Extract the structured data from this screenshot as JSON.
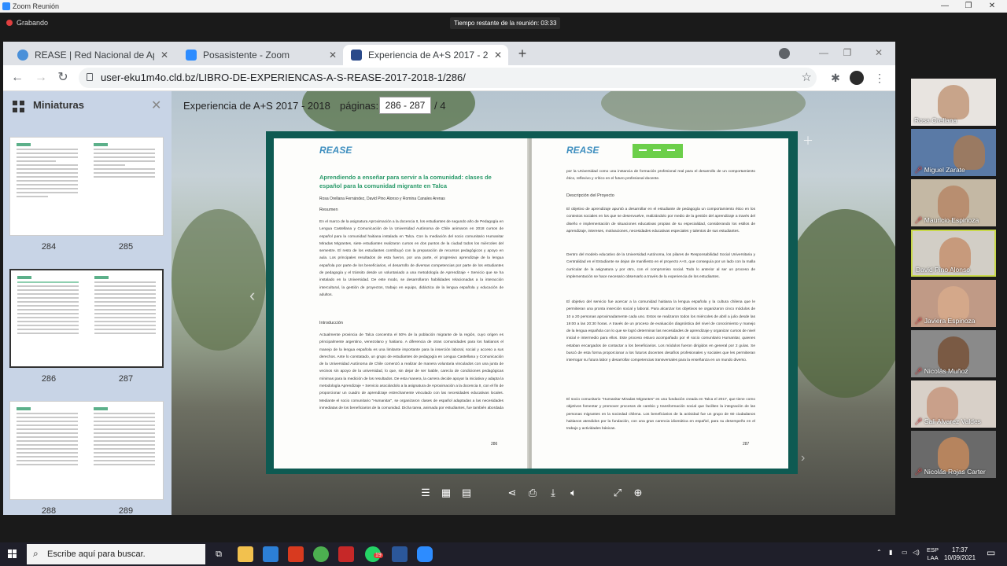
{
  "zoom": {
    "window_title": "Zoom Reunión",
    "recording_label": "Grabando",
    "timer_text": "Tiempo restante de la reunión: 03:33"
  },
  "browser": {
    "tabs": [
      {
        "label": "REASE | Red Nacional de Aprendiz",
        "icon": "globe-icon",
        "active": false
      },
      {
        "label": "Posasistente - Zoom",
        "icon": "zoom-icon",
        "active": false
      },
      {
        "label": "Experiencia de A+S 2017 - 2018",
        "icon": "book-icon",
        "active": true
      }
    ],
    "url": "user-eku1m4o.cld.bz/LIBRO-DE-EXPERIENCAS-A-S-REASE-2017-2018-1/286/"
  },
  "viewer": {
    "thumbs_title": "Miniaturas",
    "title": "Experiencia de A+S 2017 - 2018",
    "pages_label": "páginas:",
    "pages_value": "286 - 287",
    "pages_total": "/ 4",
    "thumb_pages": [
      {
        "left": "284",
        "right": "285"
      },
      {
        "left": "286",
        "right": "287"
      },
      {
        "left": "288",
        "right": "289"
      }
    ]
  },
  "page_left": {
    "logo": "REASE",
    "heading": "Aprendiendo a enseñar para servir a la comunidad: clases de español para la comunidad migrante en Talca",
    "authors": "Rosa Orellana Fernández, David Pino Alonso y Romina Canales Arenas",
    "resumen_title": "Resumen",
    "resumen": "En el marco de la asignatura Aproximación a la docencia II, los estudiantes de segundo año de Pedagogía en Lengua Castellana y Comunicación de la Universidad Autónoma de Chile animaron en 2018 cursos de español para la comunidad haitiana instalada en Talca. Con la mediación del socio comunitario Humanitar Miradas Migrantes, siete estudiantes realizaron cursos en dos puntos de la ciudad todos los miércoles del semestre. El resto de los estudiantes contribuyó con la preparación de recursos pedagógicos y apoyo en aula. Los principales resultados de esta fueron, por una parte, el progresivo aprendizaje de la lengua española por parte de los beneficiarios, el desarrollo de diversas competencias por parte de los estudiantes de pedagogía y el tránsito desde un voluntariado a una metodología de Aprendizaje + Servicio que se ha instalado en la Universidad. De este modo, se desarrollaron habilidades relacionadas a la interacción intercultural, la gestión de proyectos, trabajo en equipo, didáctica de la lengua española y educación de adultos.",
    "intro_title": "Introducción",
    "intro": "Actualmente provincia de Talca concentra el 50% de la población migrante de la región, cuyo origen es principalmente argentino, venezolano y haitiano. A diferencia de otras comunidades para los haitianos el manejo de la lengua española es una limitante importante para la inserción laboral, social y acceso a sus derechos. Ante lo constatado, un grupo de estudiantes de pedagogía en Lengua Castellana y Comunicación de la Universidad Autónoma de Chile comenzó a realizar de manera voluntaria vinculados con una junta de vecinos sin apoyo de la universidad, lo que, sin dejar de ser loable, carecía de condiciones pedagógicas mínimas para la medición de los resultados. De esta manera, la carrera decide apoyar la iniciativa y adapta la metodología Aprendizaje + Servicio asociándolo a la asignatura de Aproximación a la docencia II, con el fin de proporcionar un cuadro de aprendizaje estrechamente vinculado con las necesidades educativas locales. Mediante el socio comunitario \"Humanitar\", se organizaron clases de español adaptadas a las necesidades inmediatas de los beneficiarios de la comunidad. Dicha tarea, animada por estudiantes, fue también abordada",
    "page_number": "286"
  },
  "page_right": {
    "logo": "REASE",
    "p1": "por la Universidad como una instancia de formación profesional real para el desarrollo de un comportamiento ético, reflexivo y crítico en el futuro profesional docente.",
    "desc_title": "Descripción del Proyecto",
    "p2": "El objetivo de aprendizaje apuntó a desarrollar en el estudiante de pedagogía un comportamiento ético en los contextos sociales en los que se desenvuelve, realizándolo por medio de la gestión del aprendizaje a través del diseño e implementación de situaciones educativas propias de su especialidad, considerando los estilos de aprendizaje, intereses, motivaciones, necesidades educativas especiales y talentos de sus estudiantes.",
    "p3": "Dentro del modelo educativo de la Universidad Autónoma, los pilares de Responsabilidad Social Universitaria y Centralidad en el Estudiante se dejan de manifiesto en el proyecto A+S, que conseguía por un lado con la malla curricular de la asignatura y por otro, con el compromiso social. Todo lo anterior al ser un proceso de implementación se hace necesario observarlo a través de la experiencia de los estudiantes.",
    "p4": "El objetivo del servicio fue acercar a la comunidad haitiana la lengua española y la cultura chilena que le permitieran una pronta inserción social y laboral. Para alcanzar los objetivos se organizaron cinco módulos de 10 a 20 personas aproximadamente cada uno. Estos se realizaron todos los miércoles de abril a julio desde las 19:00 a las 20:30 horas. A través de un proceso de evaluación diagnóstica del nivel de conocimiento y manejo de la lengua española con lo que se logró determinar las necesidades de aprendizaje y organizar cursos de nivel inicial e intermedio para ellos. Este proceso estuvo acompañado por el socio comunitario Humanitar, quienes estaban encargados de contactar a los beneficiarios. Los módulos fueron dirigidos en general por 2 guías. Se buscó de esta forma proporcionar a los futuros docentes desafíos profesionales y sociales que les permitieran interrogar su futura labor y desarrollar competencias transversales para la enseñanza en un mundo diverso.",
    "p5": "El socio comunitario \"Humanitar Miradas Migrantes\" es una fundación creada en Talca el 2017, que tiene como objetivos fomentar y promover procesos de cambio y transformación social que faciliten la integración de las personas migrantes en la sociedad chilena. Los beneficiarios de la actividad fue un grupo de 60 ciudadanos haitianos atendidos por la fundación, con una gran carencia idiomática en español, para su desempeño en el trabajo y actividades básicas.",
    "page_number": "287"
  },
  "participants": [
    {
      "name": "Rosa Orellana",
      "muted": false,
      "speaking": false,
      "face": "#c8a48a",
      "bg": "#e8e4e0"
    },
    {
      "name": "Miguel Zarate",
      "muted": true,
      "speaking": false,
      "face": "#9a7a62",
      "bg": "#5a7aa6"
    },
    {
      "name": "Mauricio Espinoza",
      "muted": true,
      "speaking": false,
      "face": "#b88e70",
      "bg": "#c4b8a4"
    },
    {
      "name": "David Pino Alonso",
      "muted": false,
      "speaking": true,
      "face": "#c79a7c",
      "bg": "#d2cec6"
    },
    {
      "name": "Javiera Espinoza",
      "muted": true,
      "speaking": false,
      "face": "#d4a88a",
      "bg": "#c09a86"
    },
    {
      "name": "Nicolás Muñoz",
      "muted": true,
      "speaking": false,
      "face": "#7a5a44",
      "bg": "#8a8a8a"
    },
    {
      "name": "Sali Alvarez Valdes",
      "muted": true,
      "speaking": false,
      "face": "#c9a08a",
      "bg": "#d8d0c8"
    },
    {
      "name": "Nicolás Rojas Carter",
      "muted": true,
      "speaking": false,
      "face": "#b6845e",
      "bg": "#6a6a6a"
    }
  ],
  "taskbar": {
    "search_placeholder": "Escribe aquí para buscar.",
    "lang_top": "ESP",
    "lang_bottom": "LAA",
    "time": "17:37",
    "date": "10/09/2021",
    "badge": "19"
  }
}
